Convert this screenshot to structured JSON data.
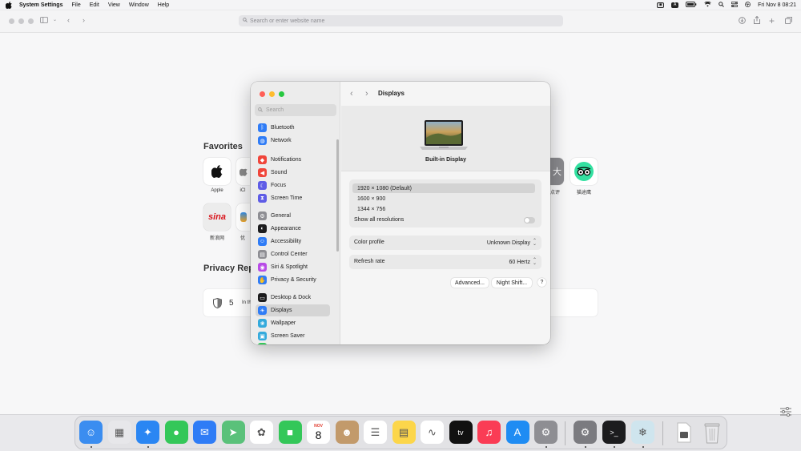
{
  "menubar": {
    "app_name": "System Settings",
    "menus": [
      "File",
      "Edit",
      "View",
      "Window",
      "Help"
    ],
    "input_indicator": "A",
    "clock": "Fri Nov 8  08:21"
  },
  "browser": {
    "address_placeholder": "Search or enter website name",
    "favorites_title": "Favorites",
    "favorites": [
      {
        "label": "Apple"
      },
      {
        "label": "iCl"
      },
      {
        "label": "新浪网"
      },
      {
        "label": "优"
      },
      {
        "label": "点评"
      },
      {
        "label": "猫途鹰"
      }
    ],
    "sina_logo_text": "sina",
    "privacy_title": "Privacy Rep",
    "privacy_count": "5",
    "privacy_text": "In th"
  },
  "settings": {
    "search_placeholder": "Search",
    "sidebar_items": [
      {
        "label": "Bluetooth",
        "color": "#2f7cf6",
        "icon": "bluetooth-icon",
        "glyph": "ᛒ"
      },
      {
        "label": "Network",
        "color": "#2f7cf6",
        "icon": "globe-icon",
        "glyph": "◍"
      },
      {
        "label": "Notifications",
        "color": "#f0453a",
        "icon": "bell-icon",
        "glyph": "◆"
      },
      {
        "label": "Sound",
        "color": "#f0453a",
        "icon": "speaker-icon",
        "glyph": "◀"
      },
      {
        "label": "Focus",
        "color": "#5e5ce6",
        "icon": "moon-icon",
        "glyph": "☾"
      },
      {
        "label": "Screen Time",
        "color": "#5e5ce6",
        "icon": "hourglass-icon",
        "glyph": "⧗"
      },
      {
        "label": "General",
        "color": "#8e8e93",
        "icon": "gear-icon",
        "glyph": "⚙"
      },
      {
        "label": "Appearance",
        "color": "#1c1c1e",
        "icon": "appearance-icon",
        "glyph": "◐"
      },
      {
        "label": "Accessibility",
        "color": "#2f7cf6",
        "icon": "accessibility-icon",
        "glyph": "☺"
      },
      {
        "label": "Control Center",
        "color": "#8e8e93",
        "icon": "control-center-icon",
        "glyph": "▤"
      },
      {
        "label": "Siri & Spotlight",
        "color": "#b84ce6",
        "icon": "siri-icon",
        "glyph": "◉"
      },
      {
        "label": "Privacy & Security",
        "color": "#2f7cf6",
        "icon": "hand-icon",
        "glyph": "✋"
      },
      {
        "label": "Desktop & Dock",
        "color": "#1c1c1e",
        "icon": "dock-icon",
        "glyph": "▭"
      },
      {
        "label": "Displays",
        "color": "#2f7cf6",
        "icon": "sun-icon",
        "glyph": "☀"
      },
      {
        "label": "Wallpaper",
        "color": "#34aadc",
        "icon": "wallpaper-icon",
        "glyph": "❀"
      },
      {
        "label": "Screen Saver",
        "color": "#34aadc",
        "icon": "screen-saver-icon",
        "glyph": "▣"
      },
      {
        "label": "Battery",
        "color": "#34c759",
        "icon": "battery-icon",
        "glyph": "▬"
      }
    ],
    "selected_item": "Displays",
    "title": "Displays",
    "display_name": "Built-in Display",
    "resolutions": [
      "1920 × 1080 (Default)",
      "1600 × 900",
      "1344 × 756"
    ],
    "selected_resolution": "1920 × 1080 (Default)",
    "show_all_label": "Show all resolutions",
    "show_all_enabled": false,
    "color_profile_label": "Color profile",
    "color_profile_value": "Unknown Display",
    "refresh_rate_label": "Refresh rate",
    "refresh_rate_value": "60 Hertz",
    "advanced_button": "Advanced...",
    "night_shift_button": "Night Shift...",
    "help_button": "?"
  },
  "dock": {
    "apps": [
      {
        "name": "Finder",
        "icon": "finder-icon",
        "color": "#3b8df0",
        "glyph": "☺",
        "running": true
      },
      {
        "name": "Launchpad",
        "icon": "launchpad-icon",
        "color": "#e7e7ea",
        "glyph": "▦",
        "running": false
      },
      {
        "name": "Safari",
        "icon": "safari-icon",
        "color": "#2a86f3",
        "glyph": "✦",
        "running": true
      },
      {
        "name": "Messages",
        "icon": "messages-icon",
        "color": "#34c759",
        "glyph": "●",
        "running": false
      },
      {
        "name": "Mail",
        "icon": "mail-icon",
        "color": "#2f7cf6",
        "glyph": "✉",
        "running": false
      },
      {
        "name": "Maps",
        "icon": "maps-icon",
        "color": "#5ac17a",
        "glyph": "➤",
        "running": false
      },
      {
        "name": "Photos",
        "icon": "photos-icon",
        "color": "#ffffff",
        "glyph": "✿",
        "running": false
      },
      {
        "name": "FaceTime",
        "icon": "facetime-icon",
        "color": "#34c759",
        "glyph": "■",
        "running": false
      },
      {
        "name": "Calendar",
        "icon": "calendar-icon",
        "color": "#ffffff",
        "glyph": "",
        "running": false
      },
      {
        "name": "Contacts",
        "icon": "contacts-icon",
        "color": "#c29a6b",
        "glyph": "☻",
        "running": false
      },
      {
        "name": "Reminders",
        "icon": "reminders-icon",
        "color": "#ffffff",
        "glyph": "☰",
        "running": false
      },
      {
        "name": "Notes",
        "icon": "notes-icon",
        "color": "#fcd64a",
        "glyph": "▤",
        "running": false
      },
      {
        "name": "Freeform",
        "icon": "freeform-icon",
        "color": "#ffffff",
        "glyph": "∿",
        "running": false
      },
      {
        "name": "TV",
        "icon": "tv-icon",
        "color": "#111111",
        "glyph": "tv",
        "running": false
      },
      {
        "name": "Music",
        "icon": "music-icon",
        "color": "#fa3c55",
        "glyph": "♫",
        "running": false
      },
      {
        "name": "App Store",
        "icon": "app-store-icon",
        "color": "#1f8cf3",
        "glyph": "A",
        "running": false
      },
      {
        "name": "System Settings",
        "icon": "settings-icon",
        "color": "#8e8e93",
        "glyph": "⚙",
        "running": true
      }
    ],
    "extras": [
      {
        "name": "System Settings",
        "icon": "settings-icon",
        "color": "#7b7b80",
        "glyph": "⚙",
        "running": true
      },
      {
        "name": "Terminal",
        "icon": "terminal-icon",
        "color": "#1c1c1e",
        "glyph": ">_",
        "running": true
      },
      {
        "name": "Preview",
        "icon": "preview-icon",
        "color": "#cfe5ee",
        "glyph": "❄",
        "running": true
      }
    ],
    "calendar_month": "NOV",
    "calendar_day": "8",
    "downloads": {
      "name": "Downloads",
      "icon": "downloads-icon"
    },
    "trash": {
      "name": "Trash",
      "icon": "trash-icon"
    }
  }
}
